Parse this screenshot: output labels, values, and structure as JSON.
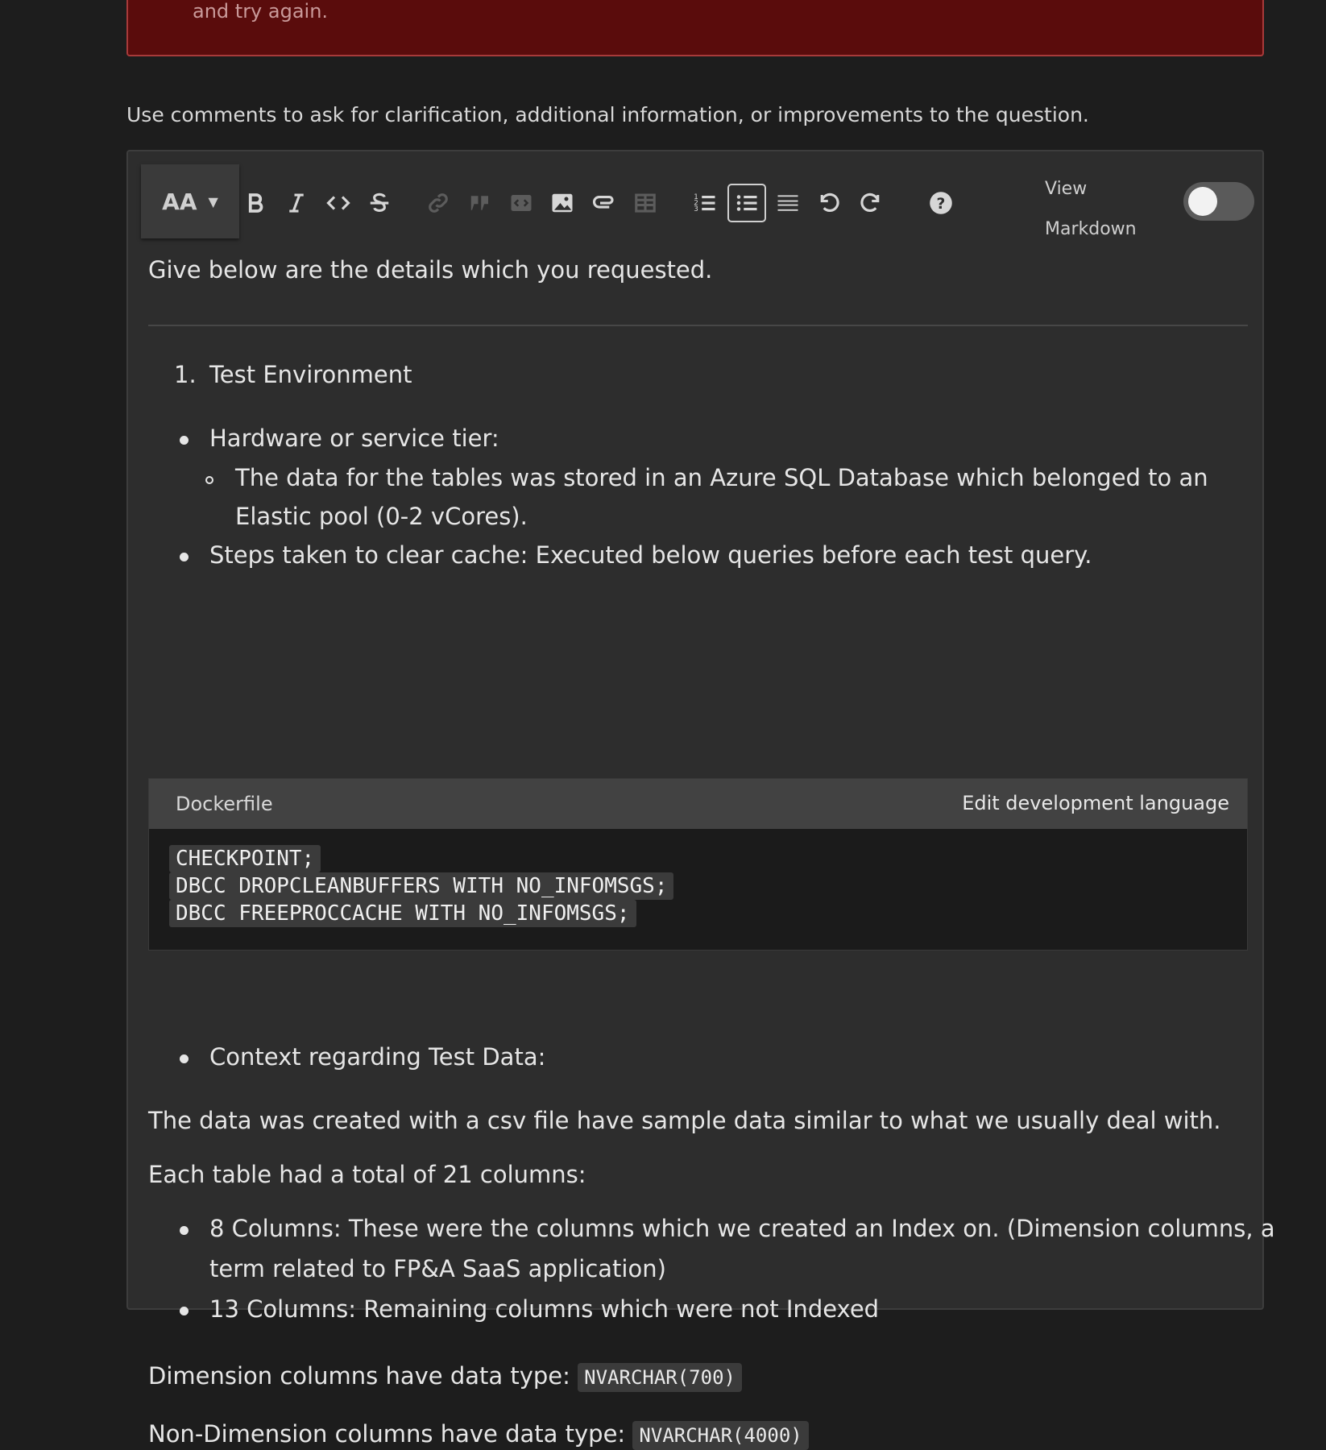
{
  "error_banner": {
    "text": "and try again."
  },
  "hint": "Use comments to ask for clarification, additional information, or improvements to the question.",
  "toolbar": {
    "font_size_label": "AA",
    "view_label": "View",
    "markdown_label": "Markdown",
    "markdown_toggle_on": false,
    "icons": [
      "bold-icon",
      "italic-icon",
      "code-icon",
      "strikethrough-icon",
      "link-icon",
      "blockquote-icon",
      "code-block-icon",
      "image-icon",
      "attachment-icon",
      "table-icon",
      "ordered-list-icon",
      "bullet-list-icon",
      "horizontal-rule-icon",
      "undo-icon",
      "redo-icon",
      "help-icon"
    ]
  },
  "content": {
    "intro": "Give below are the details which you requested.",
    "list_number": "1.",
    "section_title": "Test Environment",
    "bullet1": "Hardware or service tier:",
    "sub1_line1": "The data for the tables was stored in an Azure SQL Database which belonged to an",
    "sub1_line2": "Elastic pool (0-2 vCores).",
    "bullet2": "Steps taken to clear cache: Executed below queries before each test query.",
    "code": {
      "language": "Dockerfile",
      "edit_label": "Edit development language",
      "lines": [
        "CHECKPOINT;",
        "DBCC DROPCLEANBUFFERS WITH NO_INFOMSGS;",
        "DBCC FREEPROCCACHE WITH NO_INFOMSGS;"
      ]
    },
    "bullet3": "Context regarding Test Data:",
    "para1": "The data was created with a csv file have sample data similar to what we usually deal with.",
    "para2": "Each table had a total of 21 columns:",
    "bullet4_line1": "8 Columns: These were the columns which we created an Index on. (Dimension columns, a",
    "bullet4_line2": "term related to FP&A SaaS application)",
    "bullet5": "13 Columns: Remaining columns which were not Indexed",
    "dim_text": "Dimension columns have data type: ",
    "dim_type": "NVARCHAR(700)",
    "nondim_text": "Non-Dimension columns have data type: ",
    "nondim_type": "NVARCHAR(4000)"
  }
}
